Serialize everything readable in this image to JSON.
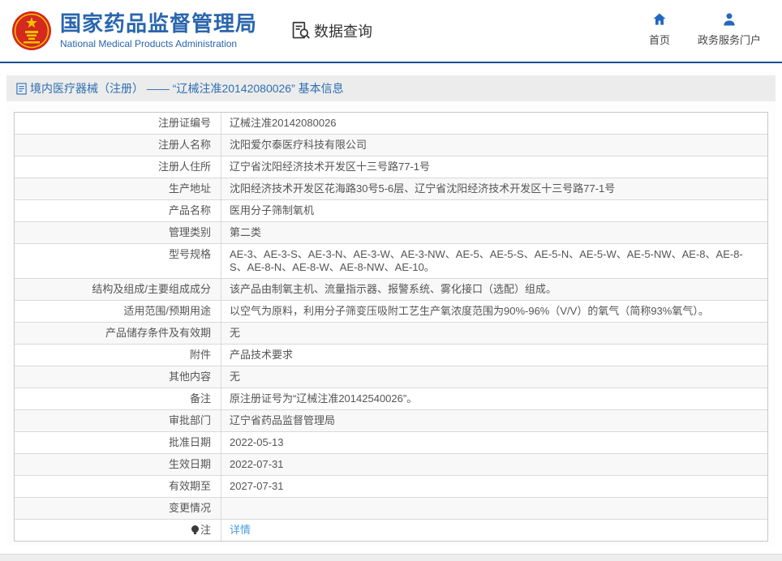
{
  "brand": {
    "emblem_icon": "china-national-emblem",
    "org_name_zh": "国家药品监督管理局",
    "org_name_en": "National Medical Products Administration"
  },
  "nav": {
    "data_query": {
      "label": "数据查询",
      "icon": "doc-search-icon"
    },
    "home": {
      "label": "首页",
      "icon": "home-icon"
    },
    "portal": {
      "label": "政务服务门户",
      "icon": "person-icon"
    }
  },
  "page": {
    "title": "境内医疗器械（注册） —— “辽械注准20142080026” 基本信息",
    "title_icon": "document-icon"
  },
  "table": {
    "rows": [
      {
        "label": "注册证编号",
        "value": "辽械注准20142080026"
      },
      {
        "label": "注册人名称",
        "value": "沈阳爱尔泰医疗科技有限公司"
      },
      {
        "label": "注册人住所",
        "value": "辽宁省沈阳经济技术开发区十三号路77-1号"
      },
      {
        "label": "生产地址",
        "value": "沈阳经济技术开发区花海路30号5-6层、辽宁省沈阳经济技术开发区十三号路77-1号"
      },
      {
        "label": "产品名称",
        "value": "医用分子筛制氧机"
      },
      {
        "label": "管理类别",
        "value": "第二类"
      },
      {
        "label": "型号规格",
        "value": "AE-3、AE-3-S、AE-3-N、AE-3-W、AE-3-NW、AE-5、AE-5-S、AE-5-N、AE-5-W、AE-5-NW、AE-8、AE-8-S、AE-8-N、AE-8-W、AE-8-NW、AE-10。"
      },
      {
        "label": "结构及组成/主要组成成分",
        "value": "该产品由制氧主机、流量指示器、报警系统、雾化接口（选配）组成。"
      },
      {
        "label": "适用范围/预期用途",
        "value": "以空气为原料，利用分子筛变压吸附工艺生产氧浓度范围为90%-96%（V/V）的氧气（简称93%氧气）。"
      },
      {
        "label": "产品储存条件及有效期",
        "value": "无"
      },
      {
        "label": "附件",
        "value": "产品技术要求"
      },
      {
        "label": "其他内容",
        "value": "无"
      },
      {
        "label": "备注",
        "value": "原注册证号为“辽械注准20142540026”。"
      },
      {
        "label": "审批部门",
        "value": "辽宁省药品监督管理局"
      },
      {
        "label": "批准日期",
        "value": "2022-05-13"
      },
      {
        "label": "生效日期",
        "value": "2022-07-31"
      },
      {
        "label": "有效期至",
        "value": "2027-07-31"
      },
      {
        "label": "变更情况",
        "value": ""
      },
      {
        "label": "注",
        "label_icon": "bulb-icon",
        "value": "详情",
        "link": true
      }
    ]
  },
  "colors": {
    "brand_blue": "#2a66ad",
    "header_line": "#17518f",
    "title_text": "#2e6eb2",
    "link_blue": "#4a9ede",
    "icon_blue": "#2468c0",
    "row_alt_bg": "#f8f8f8",
    "table_border": "#c8c8c8",
    "emblem_red": "#d5281e",
    "emblem_gold": "#f2c200",
    "body_text": "#555555"
  }
}
